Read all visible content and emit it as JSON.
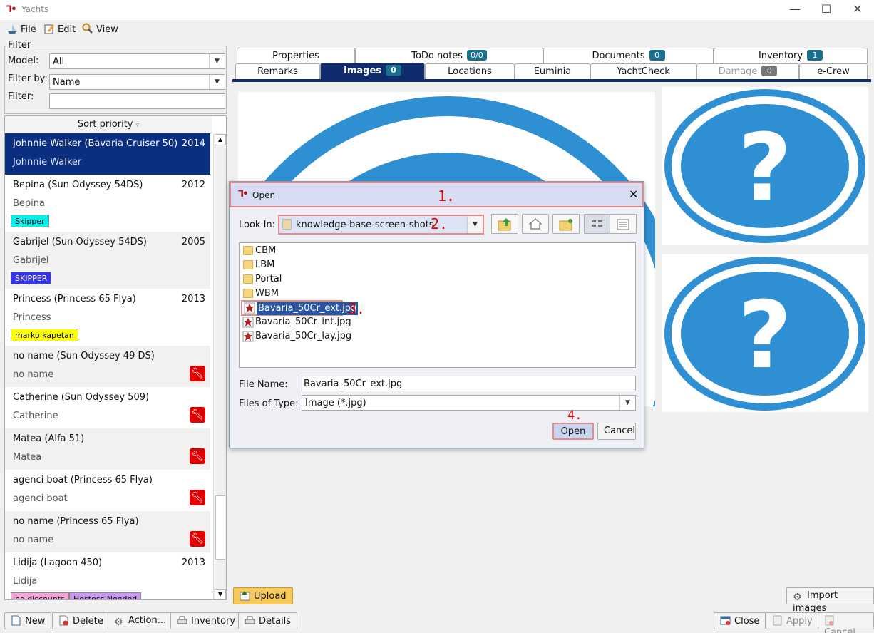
{
  "window": {
    "title": "Yachts"
  },
  "menu": {
    "file": "File",
    "edit": "Edit",
    "view": "View"
  },
  "filter": {
    "group_label": "Filter",
    "model_label": "Model:",
    "model_value": "All",
    "filterby_label": "Filter by:",
    "filterby_value": "Name",
    "filter_label": "Filter:",
    "filter_value": ""
  },
  "list": {
    "header": "Sort priority",
    "rows": [
      {
        "name": "Johnnie Walker (Bavaria Cruiser 50)",
        "year": "2014",
        "sub": "Johnnie Walker"
      },
      {
        "name": "Bepina (Sun Odyssey 54DS)",
        "year": "2012",
        "sub": "Bepina",
        "tags": [
          "Skipper"
        ]
      },
      {
        "name": "Gabrijel (Sun Odyssey 54DS)",
        "year": "2005",
        "sub": "Gabrijel",
        "tags": [
          "SKIPPER"
        ]
      },
      {
        "name": "Princess (Princess 65 Flya)",
        "year": "2013",
        "sub": "Princess",
        "tags": [
          "marko kapetan"
        ]
      },
      {
        "name": "no name (Sun Odyssey 49 DS)",
        "year": "",
        "sub": "no name"
      },
      {
        "name": "Catherine (Sun Odyssey 509)",
        "year": "",
        "sub": "Catherine"
      },
      {
        "name": "Matea (Alfa 51)",
        "year": "",
        "sub": "Matea"
      },
      {
        "name": "agenci boat (Princess 65 Flya)",
        "year": "",
        "sub": "agenci boat"
      },
      {
        "name": "no name (Princess 65 Flya)",
        "year": "",
        "sub": "no name"
      },
      {
        "name": "Lidija (Lagoon 450)",
        "year": "2013",
        "sub": "Lidija",
        "tags": [
          "no discounts",
          "Hostess Needed"
        ]
      }
    ]
  },
  "tags_colors": {
    "Skipper": "#00f0f0",
    "SKIPPER": "#3535f0",
    "marko kapetan": "#ffff00",
    "no discounts": "#f5a6d8",
    "Hostess Needed": "#c998f0"
  },
  "tabs": {
    "row1": [
      {
        "label": "Properties"
      },
      {
        "label": "ToDo notes",
        "badge": "0/0"
      },
      {
        "label": "Documents",
        "badge": "0"
      },
      {
        "label": "Inventory",
        "badge": "1"
      }
    ],
    "row2": [
      {
        "label": "Remarks"
      },
      {
        "label": "Images",
        "badge": "0"
      },
      {
        "label": "Locations"
      },
      {
        "label": "Euminia"
      },
      {
        "label": "YachtCheck"
      },
      {
        "label": "Damage",
        "badge": "0"
      },
      {
        "label": "e-Crew"
      }
    ]
  },
  "buttons": {
    "upload": "Upload",
    "import_images": "Import images",
    "new": "New",
    "delete": "Delete",
    "action": "Action...",
    "inventory": "Inventory",
    "details": "Details",
    "close": "Close",
    "apply": "Apply",
    "cancel": "Cancel"
  },
  "dialog": {
    "title": "Open",
    "look_in_label": "Look In:",
    "look_in_value": "knowledge-base-screen-shots",
    "items": [
      {
        "name": "CBM",
        "type": "folder"
      },
      {
        "name": "LBM",
        "type": "folder"
      },
      {
        "name": "Portal",
        "type": "folder"
      },
      {
        "name": "WBM",
        "type": "folder"
      },
      {
        "name": "Bavaria_50Cr_ext.jpg",
        "type": "image"
      },
      {
        "name": "Bavaria_50Cr_int.jpg",
        "type": "image"
      },
      {
        "name": "Bavaria_50Cr_lay.jpg",
        "type": "image"
      }
    ],
    "file_name_label": "File Name:",
    "file_name_value": "Bavaria_50Cr_ext.jpg",
    "files_type_label": "Files of Type:",
    "files_type_value": "Image (*.jpg)",
    "open_button": "Open",
    "cancel_button": "Cancel",
    "step_labels": [
      "1.",
      "2.",
      "3.",
      "4."
    ]
  },
  "placeholder_icon": "question-mark-icon",
  "accent_color": "#0e2b6e"
}
